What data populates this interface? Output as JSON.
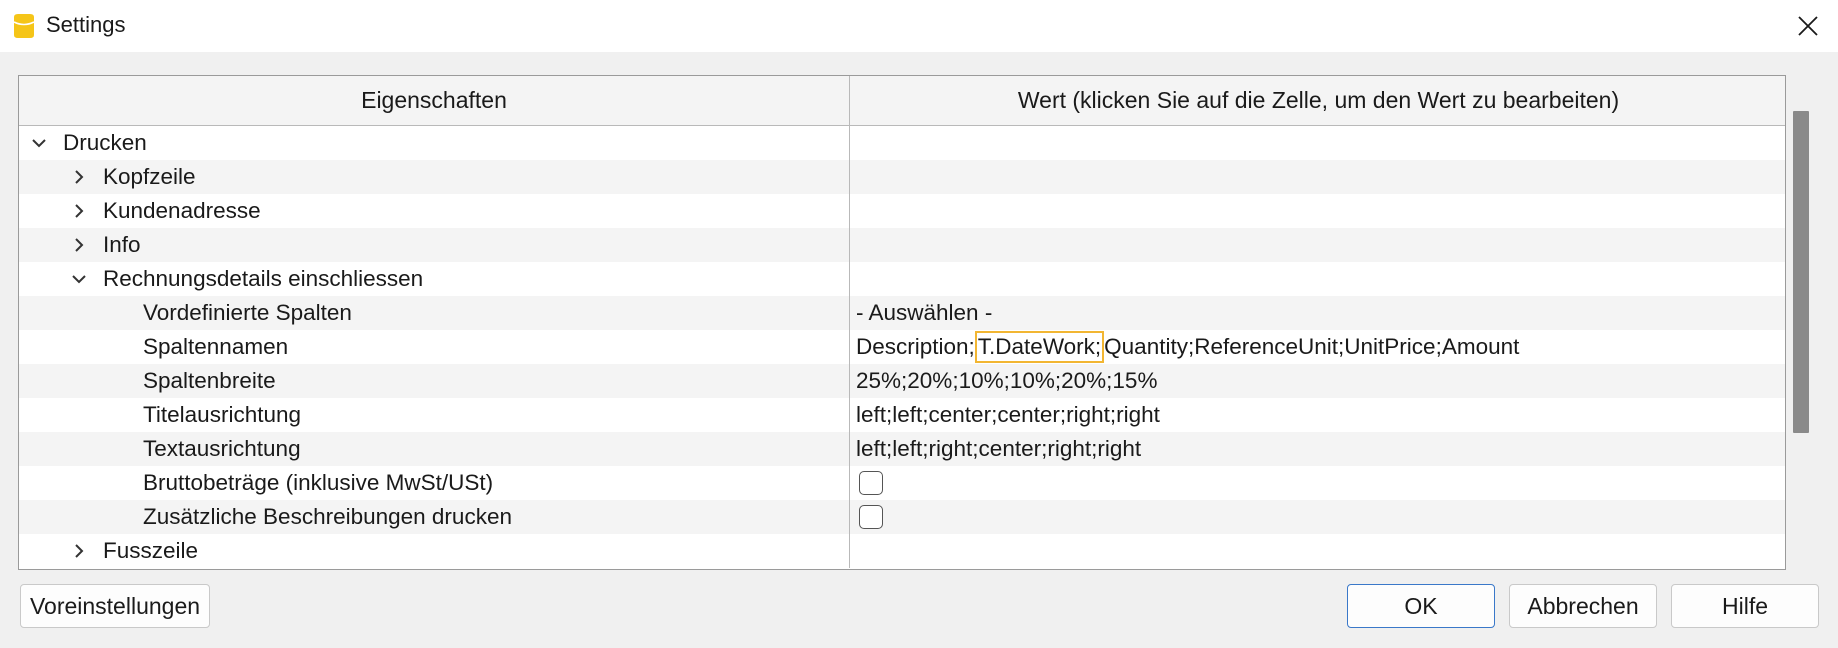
{
  "window": {
    "title": "Settings",
    "app_icon": "banana-app-icon",
    "close_icon": "close-icon"
  },
  "table": {
    "headers": {
      "property": "Eigenschaften",
      "value": "Wert (klicken Sie auf die Zelle, um den Wert zu bearbeiten)"
    },
    "rows": [
      {
        "label": "Drucken",
        "value": "",
        "level": 0,
        "expander": "chevron-down-icon"
      },
      {
        "label": "Kopfzeile",
        "value": "",
        "level": 1,
        "expander": "chevron-right-icon"
      },
      {
        "label": "Kundenadresse",
        "value": "",
        "level": 1,
        "expander": "chevron-right-icon"
      },
      {
        "label": "Info",
        "value": "",
        "level": 1,
        "expander": "chevron-right-icon"
      },
      {
        "label": "Rechnungsdetails einschliessen",
        "value": "",
        "level": 1,
        "expander": "chevron-down-icon"
      },
      {
        "label": "Vordefinierte Spalten",
        "value": "- Auswählen -",
        "level": 2
      },
      {
        "label": "Spaltennamen",
        "value_before": "Description;",
        "value_highlight": "T.DateWork;",
        "value_after": "Quantity;ReferenceUnit;UnitPrice;Amount",
        "level": 2
      },
      {
        "label": "Spaltenbreite",
        "value": "25%;20%;10%;10%;20%;15%",
        "level": 2
      },
      {
        "label": "Titelausrichtung",
        "value": "left;left;center;center;right;right",
        "level": 2
      },
      {
        "label": "Textausrichtung",
        "value": "left;left;right;center;right;right",
        "level": 2
      },
      {
        "label": "Bruttobeträge (inklusive MwSt/USt)",
        "checked": false,
        "level": 2
      },
      {
        "label": "Zusätzliche Beschreibungen drucken",
        "checked": false,
        "level": 2
      },
      {
        "label": "Fusszeile",
        "value": "",
        "level": 1,
        "expander": "chevron-right-icon"
      }
    ]
  },
  "buttons": {
    "defaults": "Voreinstellungen",
    "ok": "OK",
    "cancel": "Abbrechen",
    "help": "Hilfe"
  },
  "colors": {
    "highlight_border": "#f2b632",
    "ok_border": "#3a78c9",
    "app_icon": "#f5c518"
  }
}
